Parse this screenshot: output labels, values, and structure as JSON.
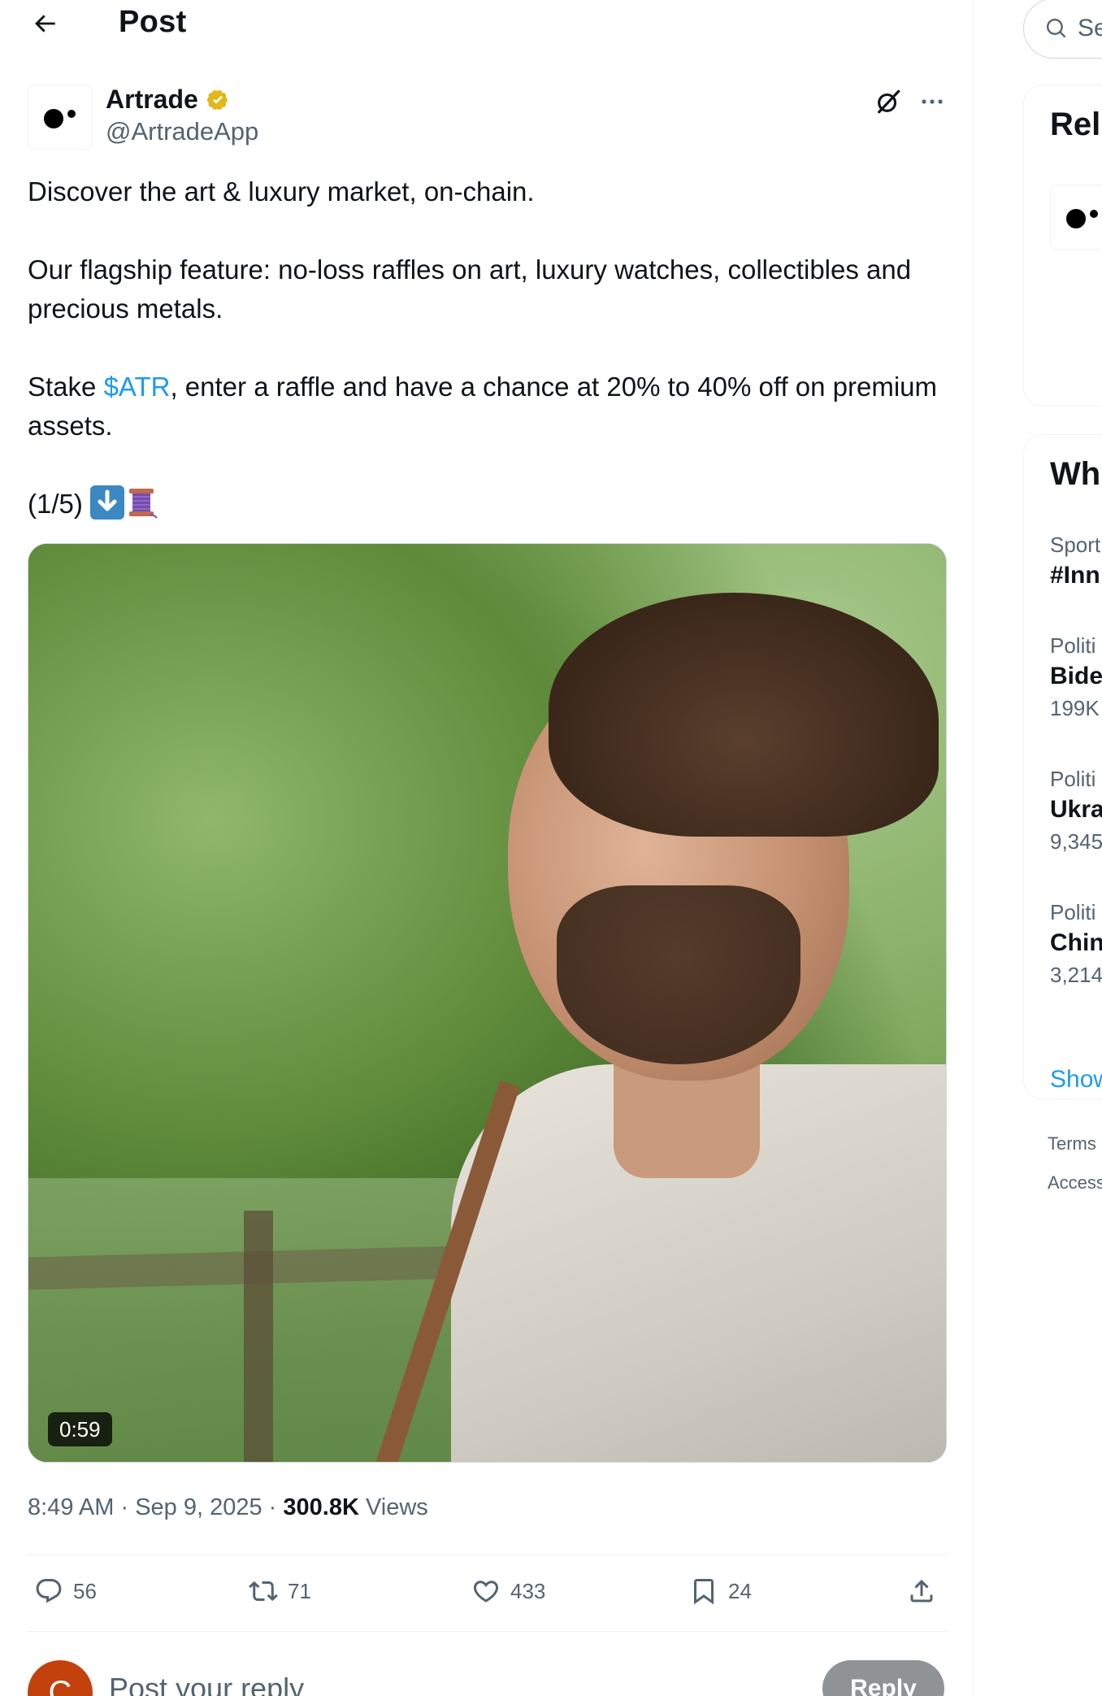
{
  "header": {
    "title": "Post"
  },
  "author": {
    "name": "Artrade",
    "handle": "@ArtradeApp"
  },
  "tweet": {
    "line1": "Discover the art & luxury market, on-chain.",
    "line2": "Our flagship feature: no-loss raffles on art, luxury watches, collectibles and precious metals.",
    "line3_prefix": "Stake ",
    "cashtag": "$ATR",
    "line3_suffix": ", enter a raffle and have a chance at 20% to 40% off on premium assets.",
    "line4": "(1/5) "
  },
  "media": {
    "duration": "0:59"
  },
  "meta": {
    "time": "8:49 AM",
    "sep1": " · ",
    "date": "Sep 9, 2025",
    "sep2": " · ",
    "views_count": "300.8K",
    "views_label": " Views"
  },
  "actions": {
    "replies": "56",
    "reposts": "71",
    "likes": "433",
    "bookmarks": "24"
  },
  "reply": {
    "avatar_letter": "C",
    "placeholder": "Post your reply",
    "button": "Reply"
  },
  "sidebar": {
    "search_placeholder": "Se",
    "relevant_title": "Rel",
    "happening_title": "Wh",
    "trends": [
      {
        "category": "Sport",
        "name": "#Inn",
        "count": ""
      },
      {
        "category": "Politi",
        "name": "Bide",
        "count": "199K"
      },
      {
        "category": "Politi",
        "name": "Ukra",
        "count": "9,345"
      },
      {
        "category": "Politi",
        "name": "Chin",
        "count": "3,214"
      }
    ],
    "show_more": "Show",
    "footer": [
      "Terms",
      "Access"
    ]
  },
  "colors": {
    "accent": "#1d9bf0",
    "text_primary": "#0f1419",
    "text_secondary": "#536471",
    "verified_gold": "#e2b719"
  }
}
